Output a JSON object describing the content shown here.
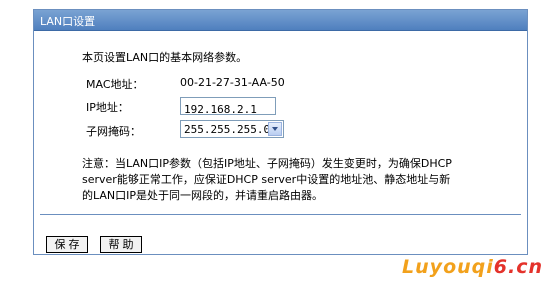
{
  "panel": {
    "title": "LAN口设置",
    "intro": "本页设置LAN口的基本网络参数。"
  },
  "fields": {
    "mac_label": "MAC地址：",
    "mac_value": "00-21-27-31-AA-50",
    "ip_label": "IP地址：",
    "ip_value": "192.168.2.1",
    "mask_label": "子网掩码：",
    "mask_value": "255.255.255.0"
  },
  "note": {
    "line1": "注意：当LAN口IP参数（包括IP地址、子网掩码）发生变更时，为确保DHCP",
    "line2": "server能够正常工作，应保证DHCP server中设置的地址池、静态地址与新",
    "line3": "的LAN口IP是处于同一网段的，并请重启路由器。"
  },
  "buttons": {
    "save": "保存",
    "help": "帮助"
  },
  "watermark": {
    "part1": "Luyouqi",
    "part2": "6.cn"
  },
  "colors": {
    "titlebar": "#5a88c4",
    "border": "#6b8fbf"
  }
}
